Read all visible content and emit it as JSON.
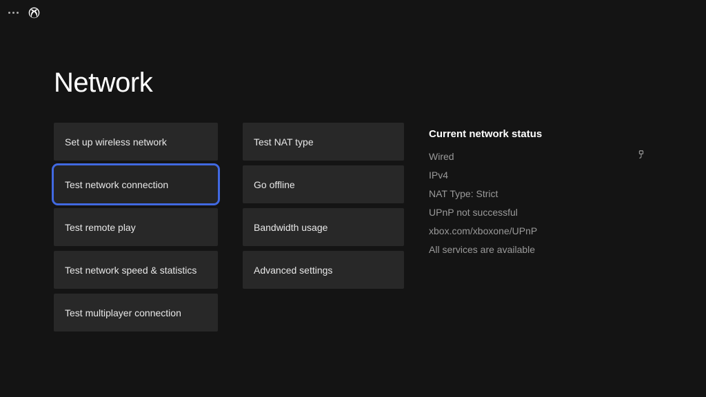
{
  "title": "Network",
  "column1": [
    {
      "key": "setup-wireless",
      "label": "Set up wireless network",
      "focused": false
    },
    {
      "key": "test-network-connection",
      "label": "Test network connection",
      "focused": true
    },
    {
      "key": "test-remote-play",
      "label": "Test remote play",
      "focused": false
    },
    {
      "key": "test-network-speed",
      "label": "Test network speed & statistics",
      "focused": false
    },
    {
      "key": "test-multiplayer",
      "label": "Test multiplayer connection",
      "focused": false
    }
  ],
  "column2": [
    {
      "key": "test-nat-type",
      "label": "Test NAT type",
      "focused": false
    },
    {
      "key": "go-offline",
      "label": "Go offline",
      "focused": false
    },
    {
      "key": "bandwidth-usage",
      "label": "Bandwidth usage",
      "focused": false
    },
    {
      "key": "advanced-settings",
      "label": "Advanced settings",
      "focused": false
    }
  ],
  "status": {
    "heading": "Current network status",
    "connection_type": "Wired",
    "ip_version": "IPv4",
    "nat": "NAT Type: Strict",
    "upnp": "UPnP not successful",
    "help_url": "xbox.com/xboxone/UPnP",
    "services": "All services are available"
  }
}
